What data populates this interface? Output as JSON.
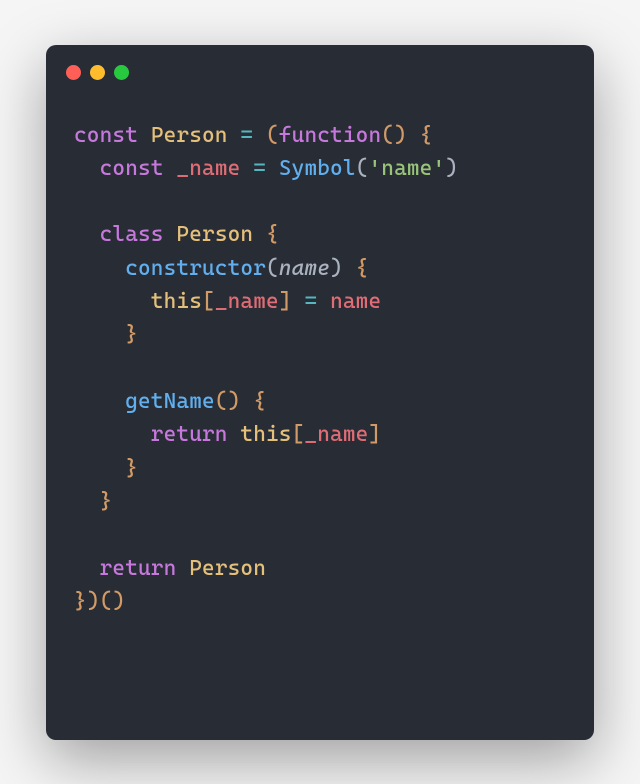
{
  "window": {
    "traffic_lights": {
      "red": "#ff5f56",
      "yellow": "#ffbd2e",
      "green": "#27c93f"
    },
    "background": "#282c34"
  },
  "code": {
    "kw_const1": "const",
    "cls_person1": "Person",
    "op_eq1": "=",
    "p_open1": "(",
    "kw_function": "function",
    "p_unit1": "()",
    "br_open1": "{",
    "kw_const2": "const",
    "var_name1": "_name",
    "op_eq2": "=",
    "fn_symbol": "Symbol",
    "p_open2": "(",
    "str_name": "'name'",
    "p_close2": ")",
    "kw_class": "class",
    "cls_person2": "Person",
    "br_open2": "{",
    "fn_ctor": "constructor",
    "p_open3": "(",
    "prm_name1": "name",
    "p_close3": ")",
    "br_open3": "{",
    "th_this1": "this",
    "sq_open1": "[",
    "var_name2": "_name",
    "sq_close1": "]",
    "op_eq3": "=",
    "var_name_rhs": "name",
    "br_close3": "}",
    "fn_getname": "getName",
    "p_unit2": "()",
    "br_open4": "{",
    "kw_return1": "return",
    "th_this2": "this",
    "sq_open2": "[",
    "var_name3": "_name",
    "sq_close2": "]",
    "br_close4": "}",
    "br_close2": "}",
    "kw_return2": "return",
    "cls_person3": "Person",
    "br_close1": "}",
    "p_close1": ")",
    "p_unit3": "()"
  }
}
